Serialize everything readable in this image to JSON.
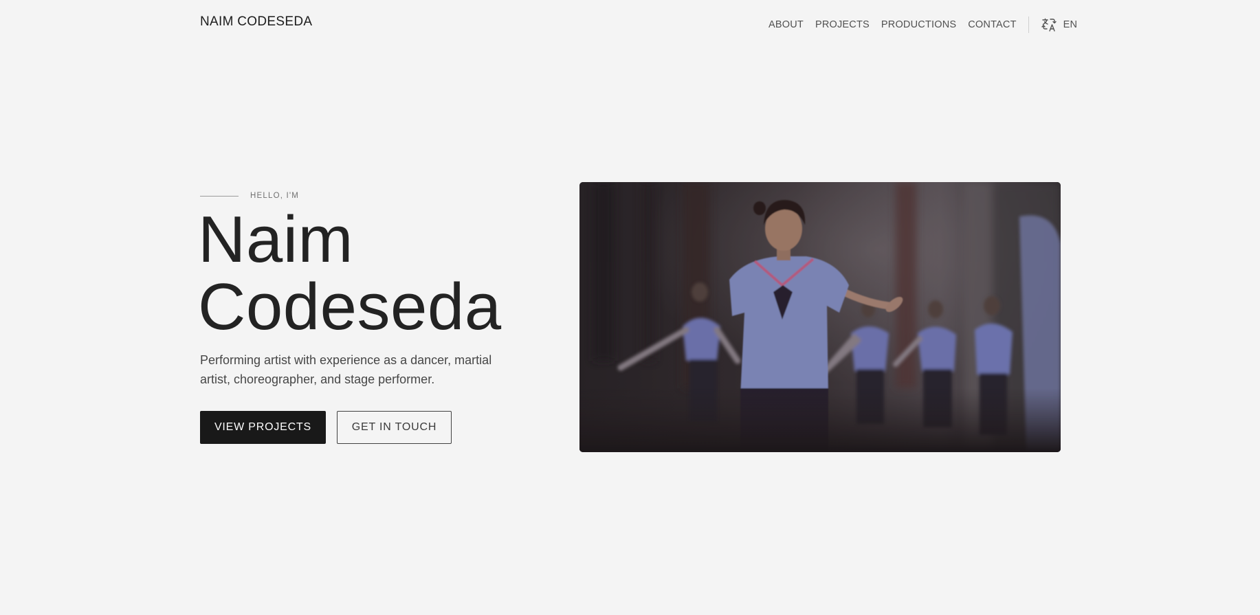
{
  "header": {
    "logo": "NAIM CODESEDA",
    "nav": [
      {
        "label": "ABOUT"
      },
      {
        "label": "PROJECTS"
      },
      {
        "label": "PRODUCTIONS"
      },
      {
        "label": "CONTACT"
      }
    ],
    "language": {
      "icon": "translate-icon",
      "label": "EN"
    }
  },
  "hero": {
    "eyebrow": "HELLO, I'M",
    "name_line1": "Naim",
    "name_line2": "Codeseda",
    "description": "Performing artist with experience as a dancer, martial artist, choreographer, and stage performer.",
    "primary_button": "VIEW PROJECTS",
    "secondary_button": "GET IN TOUCH",
    "image": "photo of dancers in blue sailor uniforms performing on stage"
  },
  "colors": {
    "background": "#f4f4f4",
    "text": "#1c1c1c",
    "primary_button_bg": "#191919"
  }
}
